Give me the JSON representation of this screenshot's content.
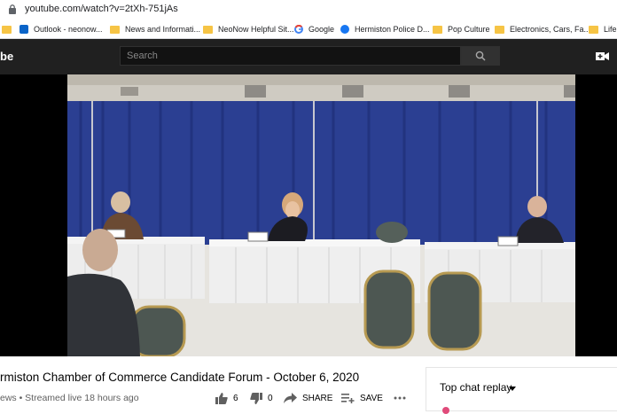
{
  "browser": {
    "url": "youtube.com/watch?v=2tXh-751jAs",
    "bookmarks": [
      {
        "label": "",
        "icon": "folder-icon"
      },
      {
        "label": "Outlook - neonow...",
        "icon": "outlook-icon"
      },
      {
        "label": "News and Informati...",
        "icon": "folder-icon"
      },
      {
        "label": "NeoNow Helpful Sit...",
        "icon": "folder-icon"
      },
      {
        "label": "Google",
        "icon": "google-icon"
      },
      {
        "label": "Hermiston Police D...",
        "icon": "facebook-icon"
      },
      {
        "label": "Pop Culture",
        "icon": "folder-icon"
      },
      {
        "label": "Electronics, Cars, Fa...",
        "icon": "folder-icon"
      },
      {
        "label": "Life H",
        "icon": "folder-icon"
      }
    ]
  },
  "youtube": {
    "logo_text": "be",
    "search_placeholder": "Search",
    "video": {
      "title": "rmiston Chamber of Commerce Candidate Forum - October 6, 2020",
      "meta": "ews • Streamed live 18 hours ago",
      "likes": "6",
      "dislikes": "0",
      "share_label": "SHARE",
      "save_label": "SAVE"
    },
    "chat": {
      "label": "Top chat replay"
    }
  },
  "colors": {
    "youtube_dark": "#202020",
    "curtain_blue": "#2b3f92",
    "folder_yellow": "#f6c445"
  }
}
